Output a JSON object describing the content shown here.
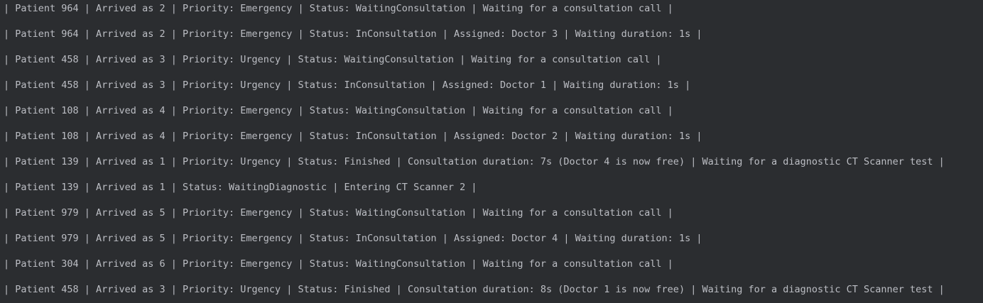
{
  "console": {
    "lines": [
      "| Patient 964 | Arrived as 2 | Priority: Emergency | Status: WaitingConsultation | Waiting for a consultation call |",
      "| Patient 964 | Arrived as 2 | Priority: Emergency | Status: InConsultation | Assigned: Doctor 3 | Waiting duration: 1s |",
      "| Patient 458 | Arrived as 3 | Priority: Urgency | Status: WaitingConsultation | Waiting for a consultation call |",
      "| Patient 458 | Arrived as 3 | Priority: Urgency | Status: InConsultation | Assigned: Doctor 1 | Waiting duration: 1s |",
      "| Patient 108 | Arrived as 4 | Priority: Emergency | Status: WaitingConsultation | Waiting for a consultation call |",
      "| Patient 108 | Arrived as 4 | Priority: Emergency | Status: InConsultation | Assigned: Doctor 2 | Waiting duration: 1s |",
      "| Patient 139 | Arrived as 1 | Priority: Urgency | Status: Finished | Consultation duration: 7s (Doctor 4 is now free) | Waiting for a diagnostic CT Scanner test |",
      "| Patient 139 | Arrived as 1 | Status: WaitingDiagnostic | Entering CT Scanner 2 |",
      "| Patient 979 | Arrived as 5 | Priority: Emergency | Status: WaitingConsultation | Waiting for a consultation call |",
      "| Patient 979 | Arrived as 5 | Priority: Emergency | Status: InConsultation | Assigned: Doctor 4 | Waiting duration: 1s |",
      "| Patient 304 | Arrived as 6 | Priority: Emergency | Status: WaitingConsultation | Waiting for a consultation call |",
      "| Patient 458 | Arrived as 3 | Priority: Urgency | Status: Finished | Consultation duration: 8s (Doctor 1 is now free) | Waiting for a diagnostic CT Scanner test |"
    ]
  }
}
